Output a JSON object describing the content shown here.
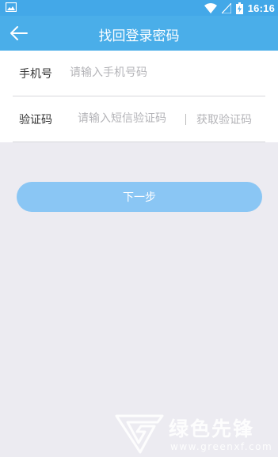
{
  "status_bar": {
    "time": "16:16",
    "icons": [
      "image-icon",
      "wifi-icon",
      "signal-icon",
      "battery-charging-icon"
    ]
  },
  "header": {
    "title": "找回登录密码",
    "back_icon": "arrow-left-icon"
  },
  "form": {
    "phone_label": "手机号",
    "phone_placeholder": "请输入手机号码",
    "phone_value": "",
    "code_label": "验证码",
    "code_placeholder": "请输入短信验证码",
    "code_value": "",
    "get_code_label": "获取验证码"
  },
  "next_button_label": "下一步",
  "watermark": {
    "text": "绿色先锋",
    "url": "www.greenxf.com"
  },
  "colors": {
    "status_bar": "#43a8e8",
    "app_bar": "#4aaee9",
    "button": "#8ac6f4",
    "background": "#ecebf1"
  }
}
